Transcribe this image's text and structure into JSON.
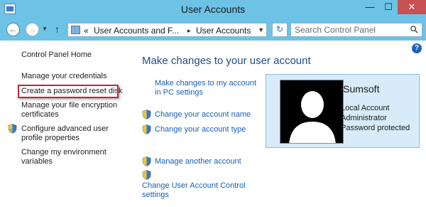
{
  "window": {
    "title": "User Accounts",
    "minimize": "—",
    "maximize": "☐",
    "close": "✕"
  },
  "address_bar": {
    "back_icon": "arrow-left-icon",
    "forward_icon": "arrow-right-icon",
    "separator": "«",
    "crumbs": [
      "User Accounts and F...",
      "User Accounts"
    ],
    "crumb_separator": "▸"
  },
  "search": {
    "placeholder": "Search Control Panel"
  },
  "help": "?",
  "left_pane": {
    "home": "Control Panel Home",
    "items": [
      "Manage your credentials",
      "Create a password reset disk",
      "Manage your file encryption",
      "certificates",
      "Configure advanced user",
      "profile properties",
      "Change my environment",
      "variables"
    ]
  },
  "main": {
    "heading": "Make changes to your user account",
    "links": [
      "Make changes to my account",
      "in PC settings",
      "Change your account name",
      "Change your account type",
      "Manage another account",
      "Change User Account Control",
      "settings"
    ]
  },
  "user": {
    "name": "iSumsoft",
    "lines": [
      "Local Account",
      "Administrator",
      "Password protected"
    ]
  },
  "colors": {
    "titlebar": "#6cc3e6",
    "link": "#1a5fb4",
    "highlight": "#c0263a",
    "card_bg": "#d7ecf8"
  }
}
